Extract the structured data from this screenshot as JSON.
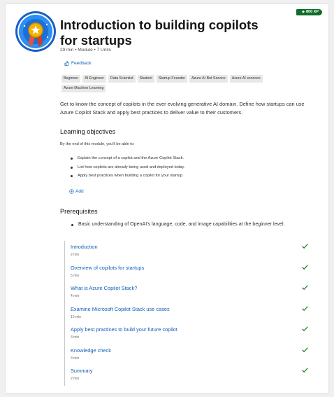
{
  "header": {
    "title": "Introduction to building copilots for startups",
    "meta": "29 min • Module • 7 Units",
    "xp": "800 XP",
    "feedback_label": "Feedback"
  },
  "tags": [
    "Beginner",
    "AI Engineer",
    "Data Scientist",
    "Student",
    "Startup Founder",
    "Azure AI Bot Service",
    "Azure AI services",
    "Azure Machine Learning"
  ],
  "description": "Get to know the concept of copilots in the ever evolving generative AI domain. Define how startups can use Azure Copilot Stack and apply best practices to deliver value to their customers.",
  "objectives": {
    "heading": "Learning objectives",
    "intro": "By the end of this module, you'll be able to:",
    "items": [
      "Explain the concept of a copilot and the Azure Copilot Stack.",
      "List how copilots are already being used and deployed today.",
      "Apply best practices when building a copilot for your startup."
    ],
    "add_label": "Add"
  },
  "prerequisites": {
    "heading": "Prerequisites",
    "items": [
      "Basic understanding of OpenAI's language, code, and image capabilities at the beginner level."
    ]
  },
  "units": [
    {
      "title": "Introduction",
      "duration": "2 min"
    },
    {
      "title": "Overview of copilots for startups",
      "duration": "5 min"
    },
    {
      "title": "What is Azure Copilot Stack?",
      "duration": "4 min"
    },
    {
      "title": "Examine Microsoft Copilot Stack use cases",
      "duration": "10 min"
    },
    {
      "title": "Apply best practices to build your future copilot",
      "duration": "3 min"
    },
    {
      "title": "Knowledge check",
      "duration": "3 min"
    },
    {
      "title": "Summary",
      "duration": "2 min"
    }
  ],
  "colors": {
    "accent": "#0f5fb8",
    "check": "#107c10",
    "xp_badge": "#0e6e2a"
  },
  "icons": {
    "badge": "medal-badge-icon",
    "feedback": "thumbs-up-icon",
    "add": "plus-circle-icon",
    "complete": "checkmark-icon"
  }
}
